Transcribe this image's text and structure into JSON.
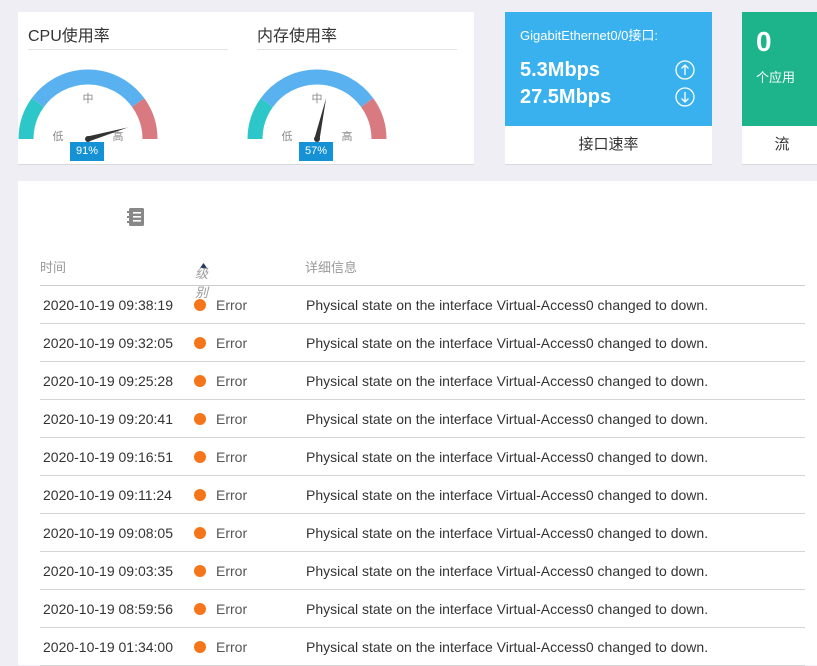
{
  "gauges": [
    {
      "title": "CPU使用率",
      "mid_label": "中",
      "low_label": "低",
      "high_label": "高",
      "value_text": "91%",
      "value": 0.91
    },
    {
      "title": "内存使用率",
      "mid_label": "中",
      "low_label": "低",
      "high_label": "高",
      "value_text": "57%",
      "value": 0.57
    }
  ],
  "gauge_colors": {
    "low": "#2ec7c9",
    "mid": "#5ab1ef",
    "high": "#d87a80",
    "needle": "#333333",
    "badge": "#1591d6"
  },
  "interface_speed": {
    "title": "GigabitEthernet0/0接口:",
    "up_value": "5.3Mbps",
    "down_value": "27.5Mbps",
    "up_icon": "arrow-up-circle-icon",
    "down_icon": "arrow-down-circle-icon",
    "footer": "接口速率",
    "color": "#39b1ee"
  },
  "apps": {
    "count": "0",
    "label": "个应用",
    "footer": "流",
    "color": "#1db48c"
  },
  "log": {
    "icon": "notebook-icon",
    "columns": {
      "time": "时间",
      "level": "级别",
      "detail": "详细信息"
    },
    "sort_icon": "sort-ascending-icon",
    "level_color": "#f5761a",
    "rows": [
      {
        "time": "2020-10-19 09:38:19",
        "level": "Error",
        "message": "Physical state on the interface Virtual-Access0 changed to down."
      },
      {
        "time": "2020-10-19 09:32:05",
        "level": "Error",
        "message": "Physical state on the interface Virtual-Access0 changed to down."
      },
      {
        "time": "2020-10-19 09:25:28",
        "level": "Error",
        "message": "Physical state on the interface Virtual-Access0 changed to down."
      },
      {
        "time": "2020-10-19 09:20:41",
        "level": "Error",
        "message": "Physical state on the interface Virtual-Access0 changed to down."
      },
      {
        "time": "2020-10-19 09:16:51",
        "level": "Error",
        "message": "Physical state on the interface Virtual-Access0 changed to down."
      },
      {
        "time": "2020-10-19 09:11:24",
        "level": "Error",
        "message": "Physical state on the interface Virtual-Access0 changed to down."
      },
      {
        "time": "2020-10-19 09:08:05",
        "level": "Error",
        "message": "Physical state on the interface Virtual-Access0 changed to down."
      },
      {
        "time": "2020-10-19 09:03:35",
        "level": "Error",
        "message": "Physical state on the interface Virtual-Access0 changed to down."
      },
      {
        "time": "2020-10-19 08:59:56",
        "level": "Error",
        "message": "Physical state on the interface Virtual-Access0 changed to down."
      },
      {
        "time": "2020-10-19 01:34:00",
        "level": "Error",
        "message": "Physical state on the interface Virtual-Access0 changed to down."
      }
    ]
  }
}
